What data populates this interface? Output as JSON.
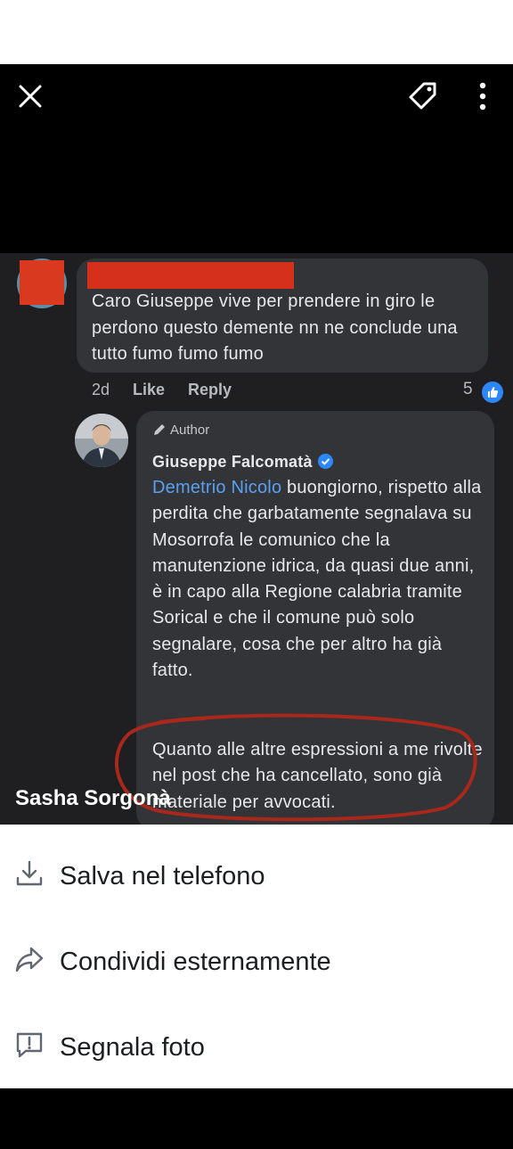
{
  "viewer": {
    "close_icon": "close-icon",
    "tag_icon": "tag-icon",
    "more_icon": "more-vertical-icon",
    "caption": "Sasha Sorgonà"
  },
  "comment1": {
    "text": "Caro Giuseppe vive  per prendere in giro le perdono questo demente  nn ne conclude una  tutto fumo fumo fumo",
    "time": "2d",
    "like_label": "Like",
    "reply_label": "Reply",
    "reaction_count": "5"
  },
  "comment2": {
    "author_badge": "Author",
    "name": "Giuseppe Falcomatà",
    "mention": "Demetrio Nicolo",
    "text_after_mention": " buongiorno, rispetto alla perdita che garbatamente segnalava su Mosorrofa le comunico che la manutenzione idrica, da quasi due anni, è in capo alla Regione calabria tramite Sorical e che il comune può solo segnalare, cosa che per altro ha già fatto.",
    "text2": "Quanto alle altre espressioni a me rivolte nel post che ha cancellato, sono già materiale per avvocati."
  },
  "sheet": {
    "items": [
      {
        "label": "Salva nel telefono",
        "icon": "download-icon"
      },
      {
        "label": "Condividi esternamente",
        "icon": "share-icon"
      },
      {
        "label": "Segnala foto",
        "icon": "report-icon"
      }
    ]
  },
  "colors": {
    "accent_blue": "#2d88ff",
    "mention_blue": "#5aa0f2",
    "redaction_red": "#d5301b",
    "circle_red": "#a8281c"
  }
}
